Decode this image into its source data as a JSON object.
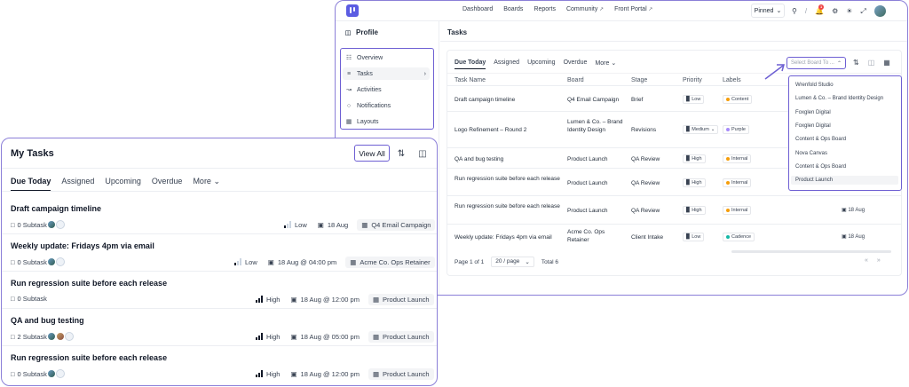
{
  "back": {
    "nav": [
      "Dashboard",
      "Boards",
      "Reports",
      "Community",
      "Front Portal"
    ],
    "nav_external": [
      false,
      false,
      false,
      true,
      true
    ],
    "pinned": "Pinned",
    "notification_count": "1",
    "sidebar": {
      "title": "Profile",
      "items": [
        {
          "label": "Overview",
          "icon": "overview-icon"
        },
        {
          "label": "Tasks",
          "icon": "tasks-icon"
        },
        {
          "label": "Activities",
          "icon": "activities-icon"
        },
        {
          "label": "Notifications",
          "icon": "bell-icon"
        },
        {
          "label": "Layouts",
          "icon": "layouts-icon"
        }
      ]
    },
    "content_title": "Tasks",
    "tabs": [
      "Due Today",
      "Assigned",
      "Upcoming",
      "Overdue",
      "More"
    ],
    "select_placeholder": "Select Board To ...",
    "columns": [
      "Task Name",
      "Board",
      "Stage",
      "Priority",
      "Labels"
    ],
    "rows": [
      {
        "task": "Draft campaign timeline",
        "board": "Q4 Email Campaign",
        "stage": "Brief",
        "priority": "Low",
        "label": "Content",
        "label_color": "#f59e0b",
        "due": ""
      },
      {
        "task": "Logo Refinement – Round 2",
        "board": "Lumen & Co. – Brand Identity Design",
        "stage": "Revisions",
        "priority": "Medium",
        "label": "Purple",
        "label_color": "#a78bfa",
        "due": ""
      },
      {
        "task": "QA and bug testing",
        "board": "Product Launch",
        "stage": "QA Review",
        "priority": "High",
        "label": "Internal",
        "label_color": "#f59e0b",
        "due": ""
      },
      {
        "task": "Run regression suite before each release",
        "board": "Product Launch",
        "stage": "QA Review",
        "priority": "High",
        "label": "Internal",
        "label_color": "#f59e0b",
        "due": ""
      },
      {
        "task": "Run regression suite before each release",
        "board": "Product Launch",
        "stage": "QA Review",
        "priority": "High",
        "label": "Internal",
        "label_color": "#f59e0b",
        "due": "18 Aug"
      },
      {
        "task": "Weekly update: Fridays 4pm via email",
        "board": "Acme Co. Ops Retainer",
        "stage": "Client Intake",
        "priority": "Low",
        "label": "Cadence",
        "label_color": "#14b8a6",
        "due": "18 Aug"
      }
    ],
    "footer": {
      "page": "Page 1 of 1",
      "per_page": "20 / page",
      "total": "Total 6",
      "prev": "«",
      "next": "»"
    },
    "dropdown": [
      "Wrenfold Studio",
      "Lumen & Co. – Brand Identity Design",
      "Foxglen Digital",
      "Foxglen Digital",
      "Content & Ops Board",
      "Nova Canvas",
      "Content & Ops Board",
      "Product Launch"
    ]
  },
  "front": {
    "title": "My Tasks",
    "view_all": "View All",
    "tabs": [
      "Due Today",
      "Assigned",
      "Upcoming",
      "Overdue",
      "More"
    ],
    "tasks": [
      {
        "title": "Draft campaign timeline",
        "subtask": "0 Subtask",
        "avatars": 2,
        "priority": "Low",
        "priority_level": 1,
        "due": "18 Aug",
        "board": "Q4 Email Campaign"
      },
      {
        "title": "Weekly update: Fridays 4pm via email",
        "subtask": "0 Subtask",
        "avatars": 2,
        "priority": "Low",
        "priority_level": 1,
        "due": "18 Aug @ 04:00 pm",
        "board": "Acme Co. Ops Retainer"
      },
      {
        "title": "Run regression suite before each release",
        "subtask": "0 Subtask",
        "avatars": 0,
        "priority": "High",
        "priority_level": 3,
        "due": "18 Aug @ 12:00 pm",
        "board": "Product Launch"
      },
      {
        "title": "QA and bug testing",
        "subtask": "2 Subtask",
        "avatars": 3,
        "priority": "High",
        "priority_level": 3,
        "due": "18 Aug @ 05:00 pm",
        "board": "Product Launch"
      },
      {
        "title": "Run regression suite before each release",
        "subtask": "0 Subtask",
        "avatars": 2,
        "priority": "High",
        "priority_level": 3,
        "due": "18 Aug @ 12:00 pm",
        "board": "Product Launch"
      }
    ]
  },
  "colors": {
    "accent": "#6d5fd3",
    "brand": "#5b5ce2",
    "notification": "#ef4444"
  }
}
